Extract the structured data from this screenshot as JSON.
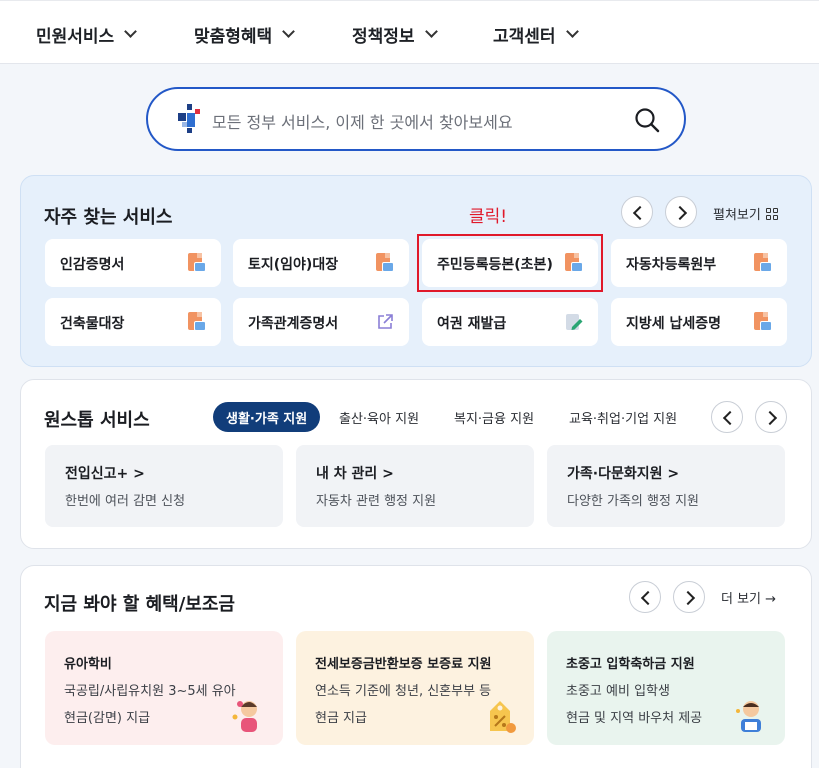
{
  "nav": {
    "items": [
      {
        "label": "민원서비스"
      },
      {
        "label": "맞춤형혜택"
      },
      {
        "label": "정책정보"
      },
      {
        "label": "고객센터"
      }
    ]
  },
  "search": {
    "placeholder": "모든 정부 서비스, 이제 한 곳에서 찾아보세요"
  },
  "favorites": {
    "title": "자주 찾는 서비스",
    "annotation": "클릭!",
    "expand_label": "펼쳐보기",
    "items": [
      {
        "label": "인감증명서",
        "icon": "document-icon"
      },
      {
        "label": "토지(임야)대장",
        "icon": "document-icon"
      },
      {
        "label": "주민등록등본(초본)",
        "icon": "document-icon"
      },
      {
        "label": "자동차등록원부",
        "icon": "document-icon"
      },
      {
        "label": "건축물대장",
        "icon": "document-icon"
      },
      {
        "label": "가족관계증명서",
        "icon": "external-link-icon"
      },
      {
        "label": "여권 재발급",
        "icon": "edit-document-icon"
      },
      {
        "label": "지방세 납세증명",
        "icon": "document-icon"
      }
    ]
  },
  "onestop": {
    "title": "원스톱 서비스",
    "tabs": [
      {
        "label": "생활·가족 지원"
      },
      {
        "label": "출산·육아 지원"
      },
      {
        "label": "복지·금융 지원"
      },
      {
        "label": "교육·취업·기업 지원"
      }
    ],
    "items": [
      {
        "title": "전입신고+ >",
        "desc": "한번에 여러 감면 신청"
      },
      {
        "title": "내 차 관리 >",
        "desc": "자동차 관련 행정 지원"
      },
      {
        "title": "가족·다문화지원 >",
        "desc": "다양한 가족의 행정 지원"
      }
    ]
  },
  "benefits": {
    "title": "지금 봐야 할 혜택/보조금",
    "more_label": "더 보기 →",
    "items": [
      {
        "title": "유아학비",
        "desc1": "국공립/사립유치원 3~5세 유아",
        "desc2": "현금(감면) 지급",
        "bg": "#fdeeee"
      },
      {
        "title": "전세보증금반환보증 보증료 지원",
        "desc1": "연소득 기준에 청년, 신혼부부 등",
        "desc2": "현금 지급",
        "bg": "#fdf2e0"
      },
      {
        "title": "초중고 입학축하금 지원",
        "desc1": "초중고 예비 입학생",
        "desc2": "현금 및 지역 바우처 제공",
        "bg": "#e9f4ee"
      }
    ]
  },
  "colors": {
    "accent": "#2358c7",
    "tab_active": "#113d7a",
    "highlight": "#e0192a"
  }
}
